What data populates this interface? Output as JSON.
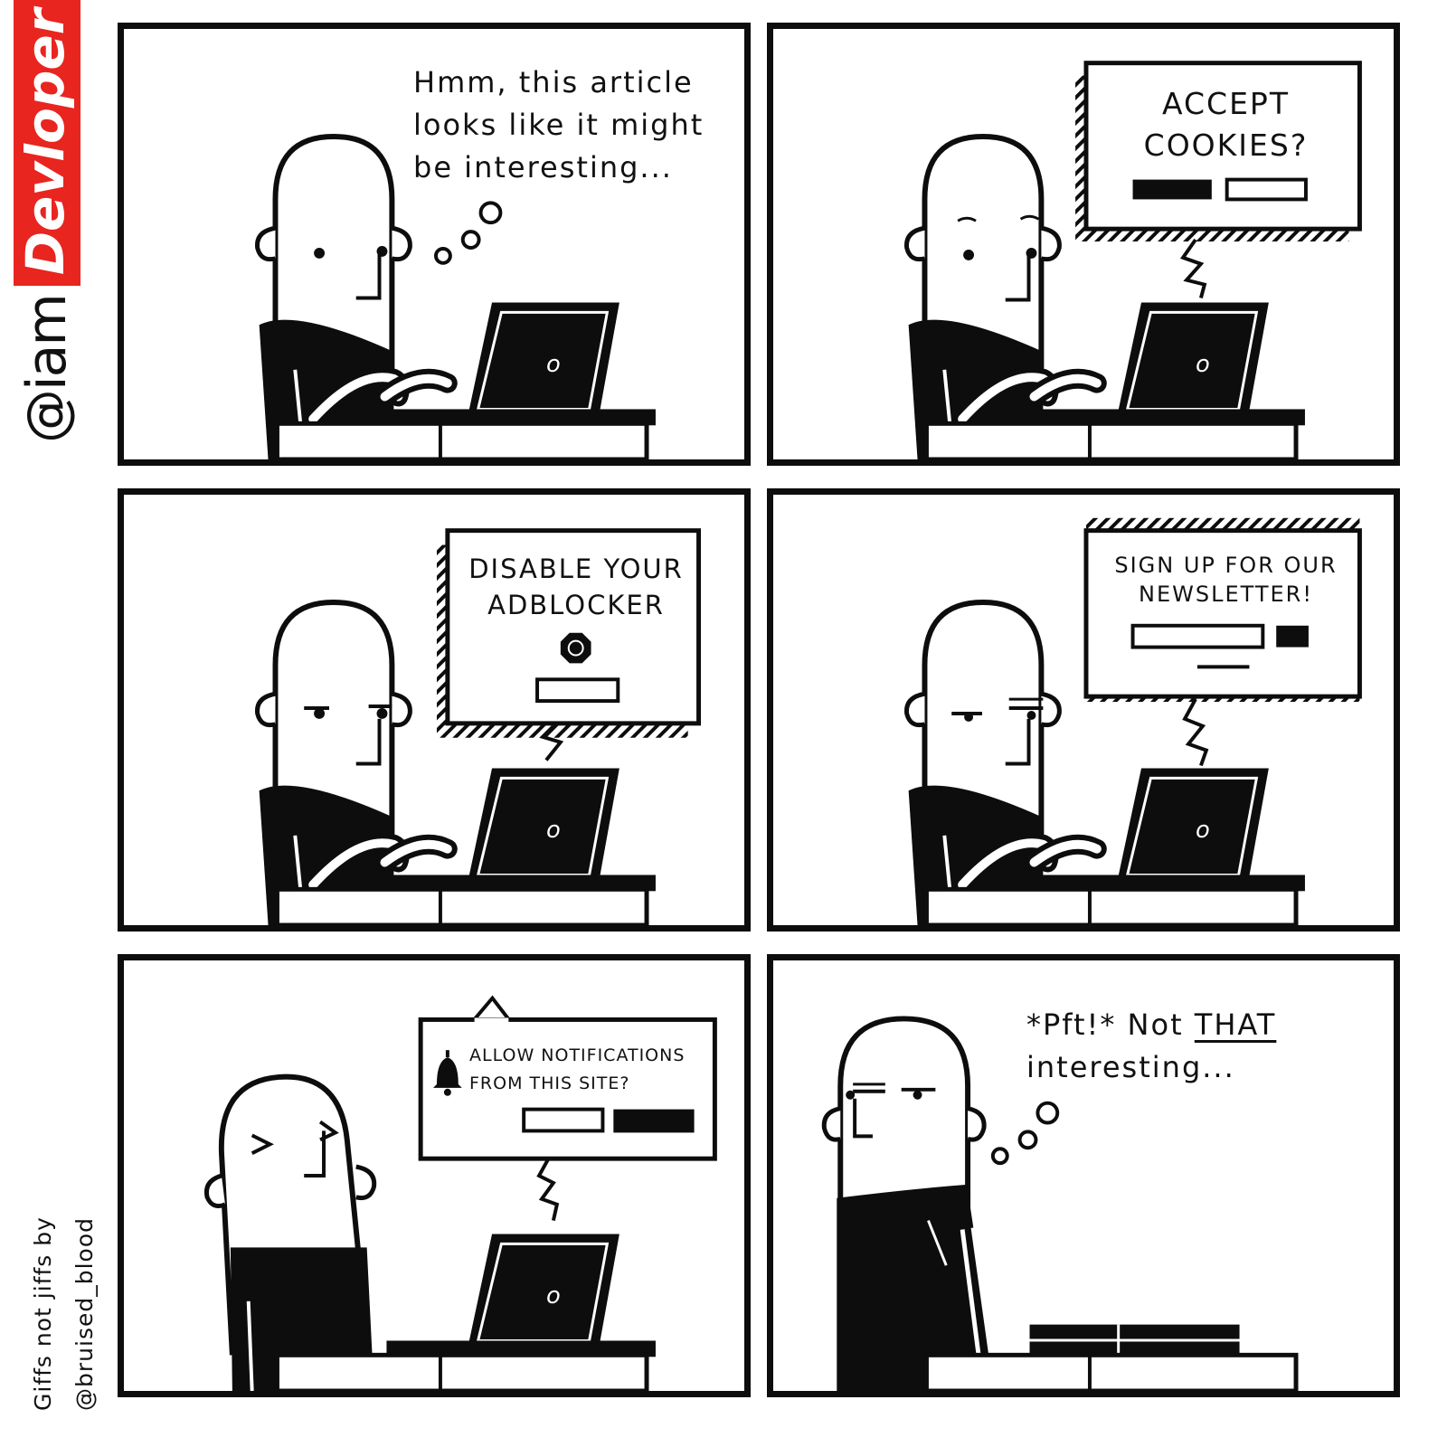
{
  "brand": {
    "at_text": "@iam",
    "badge_text": "Devloper",
    "badge_color": "#e8251f"
  },
  "credit": {
    "line1": "Giffs not jiffs by",
    "line2": "@bruised_blood"
  },
  "panels": [
    {
      "id": 1,
      "thought": {
        "line1": "Hmm, this article",
        "line2": "looks like it might",
        "line3": "be interesting..."
      }
    },
    {
      "id": 2,
      "popup": {
        "line1": "ACCEPT",
        "line2": "COOKIES?"
      }
    },
    {
      "id": 3,
      "popup": {
        "line1": "DISABLE YOUR",
        "line2": "ADBLOCKER",
        "icon": "stop-hand-icon"
      }
    },
    {
      "id": 4,
      "popup": {
        "line1": "SIGN UP FOR OUR",
        "line2": "NEWSLETTER!"
      }
    },
    {
      "id": 5,
      "popup": {
        "line1": "ALLOW NOTIFICATIONS",
        "line2": "FROM THIS SITE?",
        "icon": "bell-icon"
      }
    },
    {
      "id": 6,
      "thought": {
        "prefix": "*Pft!* Not ",
        "emphasis": "THAT",
        "line2": "interesting..."
      }
    }
  ],
  "colors": {
    "ink": "#0d0d0d",
    "paper": "#ffffff",
    "accent": "#e8251f"
  }
}
